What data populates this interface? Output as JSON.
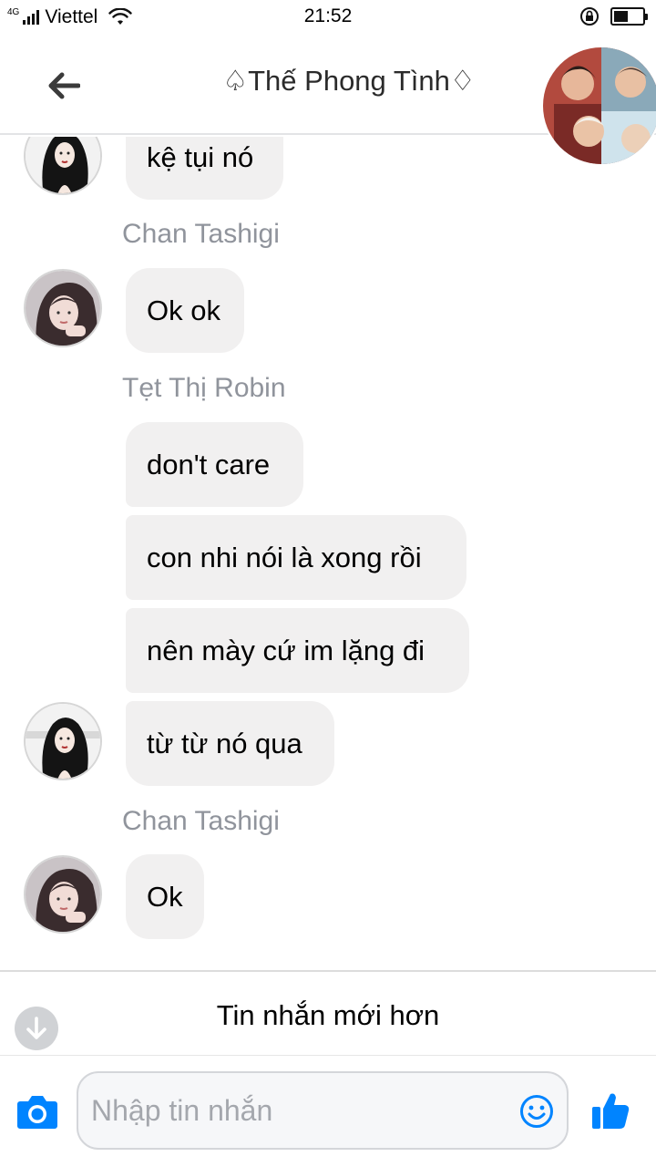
{
  "status_bar": {
    "network": "4G",
    "carrier": "Viettel",
    "time": "21:52",
    "battery_level": 0.5
  },
  "header": {
    "title": "♤Thế Phong Tình♢"
  },
  "messages": [
    {
      "type": "bubble",
      "text": "kệ tụi nó"
    },
    {
      "type": "sender",
      "text": "Chan Tashigi"
    },
    {
      "type": "bubble",
      "text": "Ok ok"
    },
    {
      "type": "sender",
      "text": "Tẹt Thị Robin"
    },
    {
      "type": "bubble",
      "text": "don't care"
    },
    {
      "type": "bubble",
      "text": "con nhi nói là xong rồi"
    },
    {
      "type": "bubble",
      "text": "nên mày cứ im lặng đi"
    },
    {
      "type": "bubble",
      "text": "từ từ nó qua"
    },
    {
      "type": "sender",
      "text": "Chan Tashigi"
    },
    {
      "type": "bubble",
      "text": "Ok"
    }
  ],
  "newer_messages": {
    "label": "Tin nhắn mới hơn"
  },
  "composer": {
    "placeholder": "Nhập tin nhắn",
    "value": ""
  },
  "colors": {
    "accent": "#0084ff",
    "bubble": "#f1f0f0",
    "sender_name": "#90949c"
  }
}
